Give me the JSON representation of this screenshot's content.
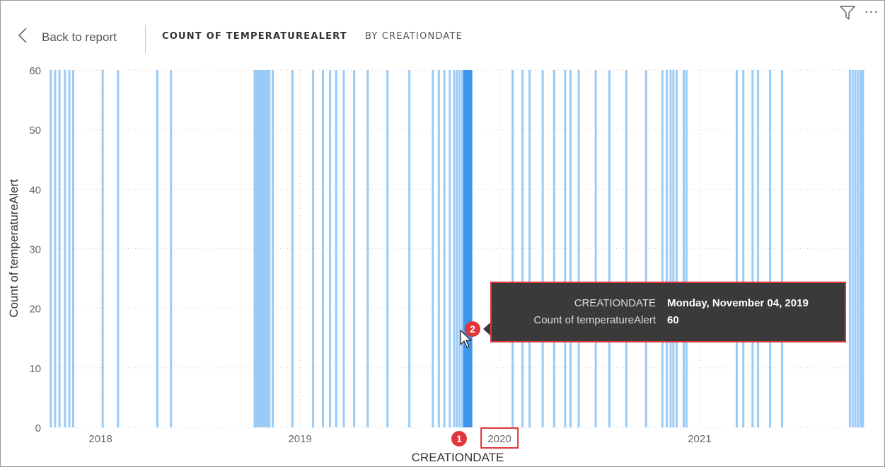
{
  "header": {
    "back_label": "Back to report",
    "title": "COUNT OF TEMPERATUREALERT",
    "subtitle": "BY CREATIONDATE"
  },
  "toolbar": {
    "filter_icon": "filter-icon",
    "more_icon": "more-options-icon",
    "more_glyph": "···"
  },
  "tooltip": {
    "field1_label": "CREATIONDATE",
    "field1_value": "Monday, November 04, 2019",
    "field2_label": "Count of temperatureAlert",
    "field2_value": "60"
  },
  "callouts": {
    "one": "1",
    "two": "2"
  },
  "colors": {
    "bar_light": "#99cbf7",
    "bar_dark": "#3e96ec",
    "grid": "#c8c8c8",
    "highlight_box": "#e0353a"
  },
  "chart_data": {
    "type": "bar",
    "xlabel": "CREATIONDATE",
    "ylabel": "Count of temperatureAlert",
    "ylim": [
      0,
      60
    ],
    "yticks": [
      0,
      10,
      20,
      30,
      40,
      50,
      60
    ],
    "xlim": [
      "2017-10-01",
      "2021-10-31"
    ],
    "xticks": [
      "2018",
      "2019",
      "2020",
      "2021"
    ],
    "highlighted_tick": "2020",
    "grid": true,
    "series": [
      {
        "x": [
          "2017-10-02",
          "2017-10-10",
          "2017-10-18",
          "2017-10-28",
          "2017-11-05",
          "2017-11-12",
          "2018-01-05",
          "2018-02-02",
          "2018-04-15",
          "2018-05-10",
          "2018-10-10",
          "2018-10-13",
          "2018-10-16",
          "2018-10-19",
          "2018-10-22",
          "2018-10-25",
          "2018-10-28",
          "2018-10-31",
          "2018-11-03",
          "2018-11-06",
          "2018-11-12",
          "2018-12-18",
          "2019-01-25",
          "2019-02-12",
          "2019-02-25",
          "2019-03-08",
          "2019-03-22",
          "2019-04-10",
          "2019-05-05",
          "2019-06-10",
          "2019-07-20",
          "2019-09-01",
          "2019-09-12",
          "2019-09-22",
          "2019-10-02",
          "2019-10-10",
          "2019-10-15",
          "2019-10-20",
          "2019-10-25",
          "2019-10-30",
          "2019-11-04",
          "2019-11-09",
          "2020-01-25",
          "2020-02-12",
          "2020-02-25",
          "2020-03-20",
          "2020-04-10",
          "2020-04-30",
          "2020-05-10",
          "2020-05-25",
          "2020-06-25",
          "2020-07-20",
          "2020-08-20",
          "2020-09-25",
          "2020-10-25",
          "2020-11-02",
          "2020-11-09",
          "2020-11-14",
          "2020-11-20",
          "2020-12-03",
          "2020-12-08",
          "2021-03-10",
          "2021-03-22",
          "2021-04-08",
          "2021-04-18",
          "2021-05-10",
          "2021-06-01",
          "2021-10-03",
          "2021-10-08",
          "2021-10-13",
          "2021-10-18",
          "2021-10-23",
          "2021-10-27"
        ],
        "values": [
          60,
          60,
          60,
          60,
          60,
          60,
          60,
          60,
          60,
          60,
          60,
          60,
          60,
          60,
          60,
          60,
          60,
          60,
          60,
          60,
          60,
          60,
          60,
          60,
          60,
          60,
          60,
          60,
          60,
          60,
          60,
          60,
          60,
          60,
          60,
          60,
          60,
          60,
          60,
          60,
          60,
          60,
          60,
          60,
          60,
          60,
          60,
          60,
          60,
          60,
          60,
          60,
          60,
          60,
          60,
          60,
          60,
          60,
          60,
          60,
          60,
          60,
          60,
          60,
          60,
          60,
          60,
          60,
          60,
          60,
          60,
          60,
          60
        ]
      }
    ]
  }
}
